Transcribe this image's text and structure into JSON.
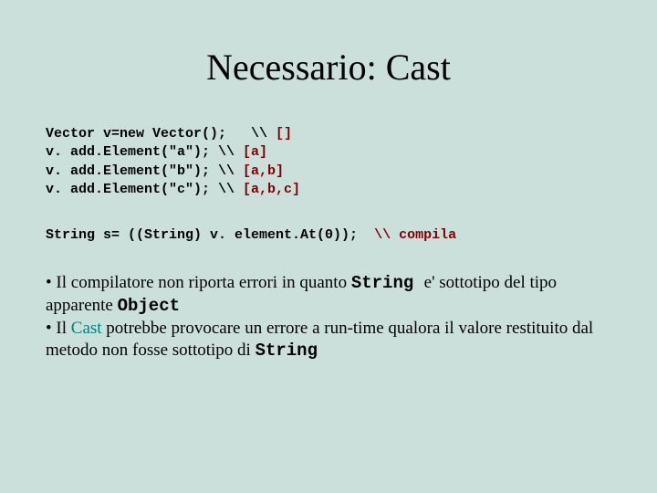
{
  "title": "Necessario: Cast",
  "code": {
    "l1a": "Vector v=new Vector();   \\\\ ",
    "l1b": "[]",
    "l2a": "v. add.Element(\"a\"); \\\\ ",
    "l2b": "[a]",
    "l3a": "v. add.Element(\"b\"); \\\\ ",
    "l3b": "[a,b]",
    "l4a": "v. add.Element(\"c\"); \\\\ ",
    "l4b": "[a,b,c]"
  },
  "code2": {
    "a": "String s= ((String) v. element.At(0));  ",
    "b": "\\\\ compila"
  },
  "body": {
    "b1_pre": "• Il compilatore non riporta errori in quanto ",
    "b1_code": "String ",
    "b1_mid": " e' sottotipo del tipo apparente ",
    "b1_code2": "Object",
    "b2_pre": "• Il  ",
    "b2_cast": "Cast ",
    "b2_mid": " potrebbe provocare un errore a run-time qualora il valore restituito dal metodo non fosse sottotipo di ",
    "b2_code": "String"
  }
}
